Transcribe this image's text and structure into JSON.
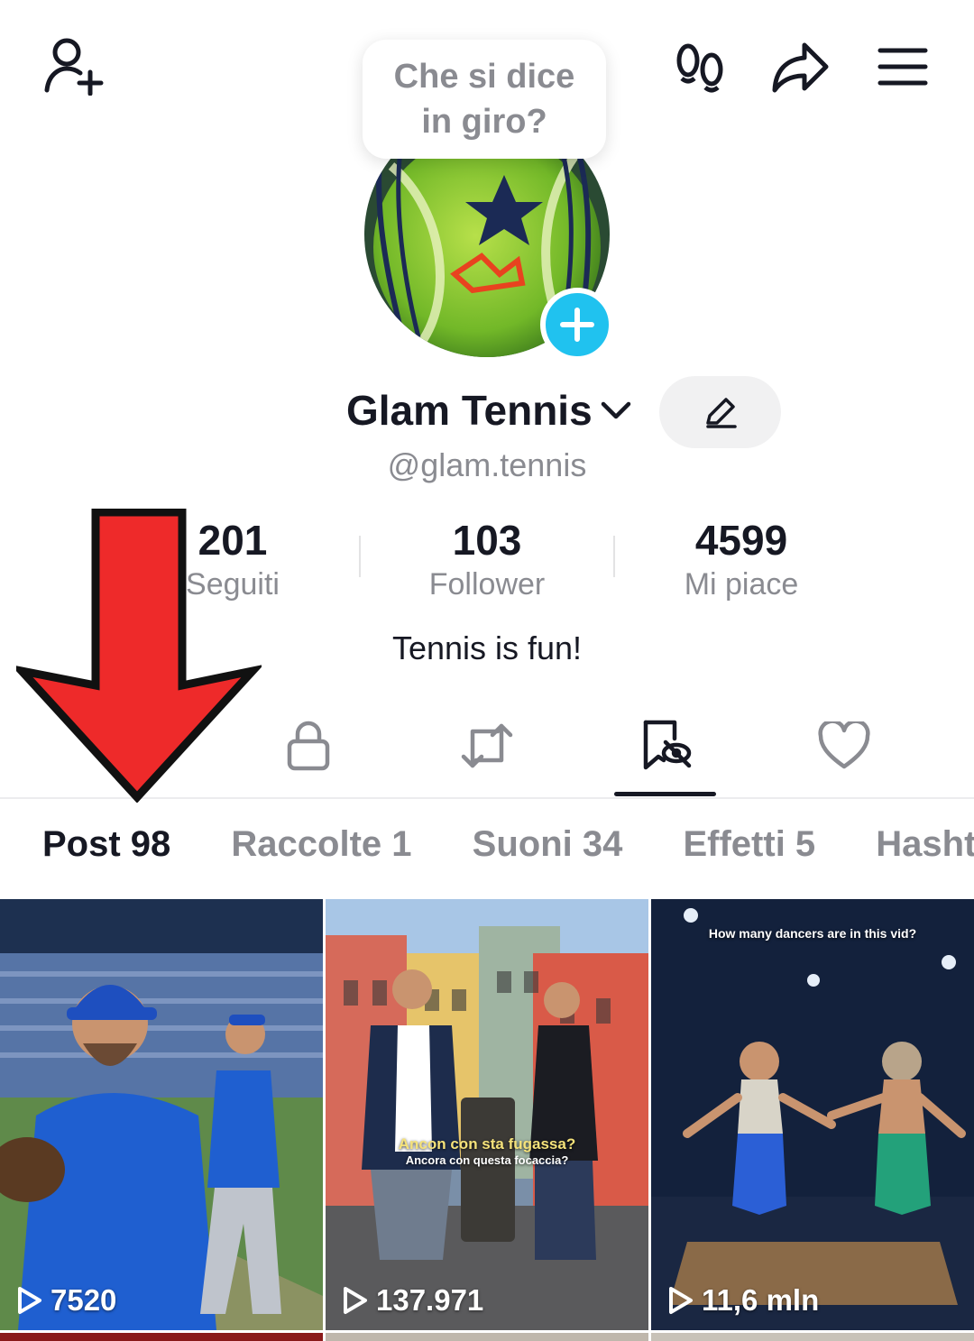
{
  "header": {
    "add_friend_icon": "person-plus-icon",
    "footprints_icon": "footprints-icon",
    "share_icon": "share-arrow-icon",
    "menu_icon": "hamburger-menu-icon"
  },
  "bubble": {
    "text": "Che si dice in giro?"
  },
  "profile": {
    "name": "Glam Tennis",
    "handle": "@glam.tennis",
    "bio": "Tennis is fun!"
  },
  "stats": [
    {
      "value": "201",
      "label": "Seguiti"
    },
    {
      "value": "103",
      "label": "Follower"
    },
    {
      "value": "4599",
      "label": "Mi piace"
    }
  ],
  "content_tabs": [
    "lock-icon",
    "repost-icon",
    "favorites-hidden-icon",
    "heart-icon"
  ],
  "subtabs": [
    {
      "label": "Post 98"
    },
    {
      "label": "Raccolte 1"
    },
    {
      "label": "Suoni 34"
    },
    {
      "label": "Effetti 5"
    },
    {
      "label": "Hashtag"
    }
  ],
  "videos": [
    {
      "views": "7520"
    },
    {
      "views": "137.971",
      "caption1": "Ancon con sta fugassa?",
      "caption2": "Ancora con questa focaccia?"
    },
    {
      "views": "11,6 mln",
      "caption1": "How many dancers are in this vid?"
    }
  ],
  "colors": {
    "accent": "#20c2ef",
    "annotation_arrow": "#ee2a2a"
  }
}
